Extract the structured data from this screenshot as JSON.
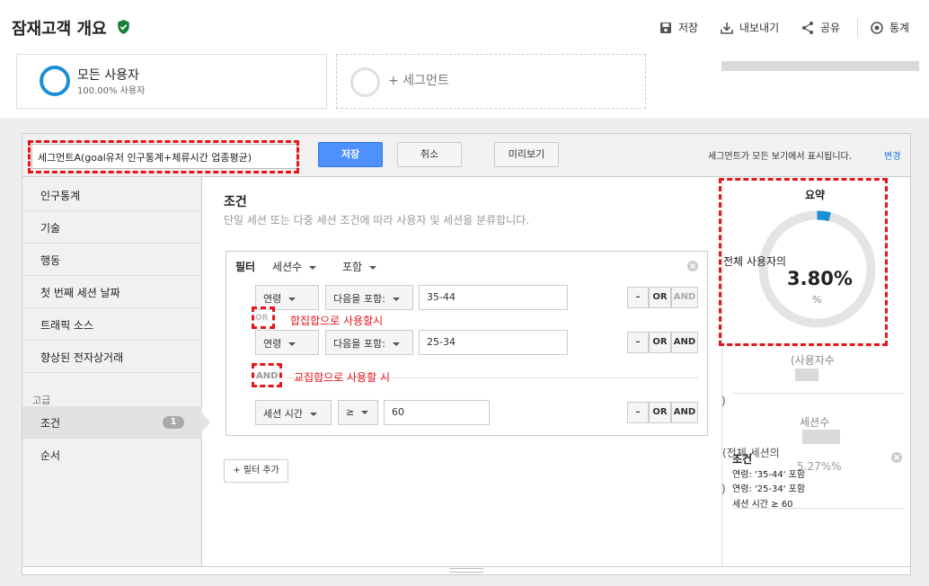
{
  "header": {
    "title": "잠재고객 개요",
    "actions": {
      "save": "저장",
      "export": "내보내기",
      "share": "공유",
      "insights": "통계"
    }
  },
  "segments": {
    "active": {
      "name": "모든 사용자",
      "sub": "100.00% 사용자"
    },
    "add_label": "+ 세그먼트"
  },
  "toolbar": {
    "segment_name": "세그먼트A(goal유저 인구통계+체류시간 업종평균)",
    "save": "저장",
    "cancel": "취소",
    "preview": "미리보기",
    "visibility_note": "세그먼트가 모든 보기에서 표시됩니다.",
    "change": "변경"
  },
  "sidebar": {
    "items": [
      "인구통계",
      "기술",
      "행동",
      "첫 번째 세션 날짜",
      "트래픽 소스",
      "향상된 전자상거래"
    ],
    "advanced_label": "고급",
    "advanced_items": [
      {
        "label": "조건",
        "badge": "1"
      },
      {
        "label": "순서"
      }
    ]
  },
  "conditions": {
    "title": "조건",
    "description": "단일 세션 또는 다중 세션 조건에 따라 사용자 및 세션을 분류합니다.",
    "filter_label": "필터",
    "scope": "세션수",
    "mode": "포함",
    "rows": [
      {
        "dimension": "연령",
        "operator": "다음을 포함:",
        "value": "35-44"
      },
      {
        "dimension": "연령",
        "operator": "다음을 포함:",
        "value": "25-34"
      },
      {
        "dimension": "세션 시간",
        "operator": "≥",
        "value": "60"
      }
    ],
    "or_connector": "OR",
    "and_connector": "AND",
    "annotation_union": "합집합으로 사용할시",
    "annotation_intersection": "교집합으로 사용할 시",
    "btn_minus": "–",
    "btn_or": "OR",
    "btn_and": "AND",
    "add_filter": "+ 필터 추가"
  },
  "summary": {
    "title": "요약",
    "all_users_label": "전체 사용자의",
    "percent_value": "3.80%",
    "percent_unit": "%",
    "percent_fraction": 0.038,
    "users_label": "(사용자수",
    "paren_close_1": ")",
    "sessions_label": "세션수",
    "all_sessions_label": "(전체 세션의",
    "sessions_percent": "5.27%%",
    "paren_close_2": ")",
    "tooltip": {
      "title": "조건",
      "lines": [
        "연령: '35-44' 포함",
        "연령: '25-34' 포함",
        "세션 시간 ≥ 60"
      ]
    }
  },
  "colors": {
    "accent_blue": "#4d90fe",
    "ring_blue": "#1a8fd6",
    "annotation_red": "#e8141b",
    "verified_green": "#188038"
  }
}
